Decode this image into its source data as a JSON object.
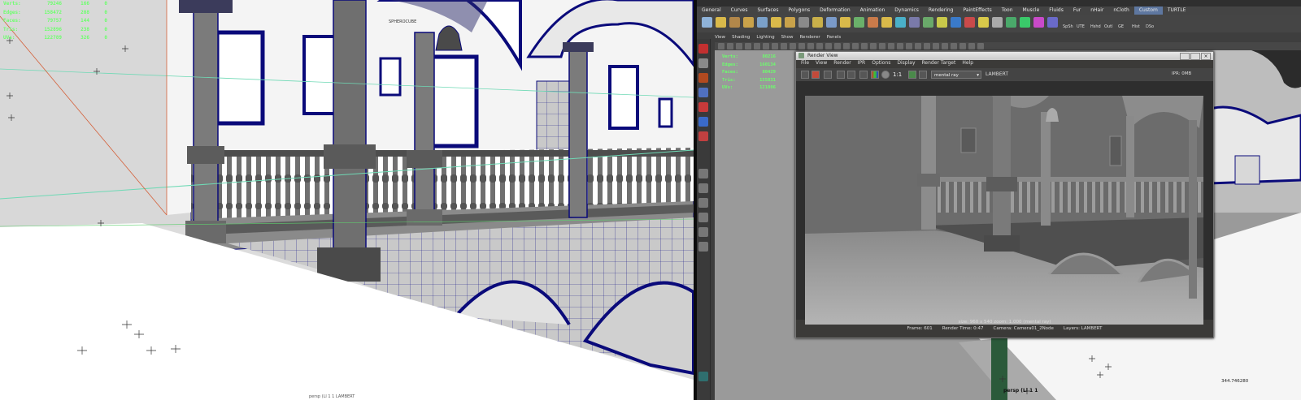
{
  "left_viewport": {
    "hud": [
      {
        "key": "Verts:",
        "v1": "79246",
        "v2": "166",
        "v3": "0"
      },
      {
        "key": "Edges:",
        "v1": "158472",
        "v2": "208",
        "v3": "0"
      },
      {
        "key": "Faces:",
        "v1": "79757",
        "v2": "144",
        "v3": "0"
      },
      {
        "key": "Tris:",
        "v1": "152896",
        "v2": "238",
        "v3": "0"
      },
      {
        "key": "UVs:",
        "v1": "122789",
        "v2": "326",
        "v3": "0"
      }
    ],
    "bell_label": "SPHEROCUBE",
    "footer_text": "persp (Ll 1 1 LAMBERT"
  },
  "shelf": {
    "tabs": [
      "General",
      "Curves",
      "Surfaces",
      "Polygons",
      "Deformation",
      "Animation",
      "Dynamics",
      "Rendering",
      "PaintEffects",
      "Toon",
      "Muscle",
      "Fluids",
      "Fur",
      "nHair",
      "nCloth",
      "Custom",
      "TURTLE"
    ],
    "active_tab": "Custom",
    "icon_labels": [
      "SpSh",
      "UTE",
      "Hshd",
      "Outl",
      "GE",
      "Hist",
      "DSo"
    ]
  },
  "viewport_menu": [
    "View",
    "Shading",
    "Lighting",
    "Show",
    "Renderer",
    "Panels"
  ],
  "right_viewport": {
    "hud": [
      {
        "key": "Verts:",
        "v1": "80216"
      },
      {
        "key": "Edges:",
        "v1": "160134"
      },
      {
        "key": "Faces:",
        "v1": "80429"
      },
      {
        "key": "Tris:",
        "v1": "155831"
      },
      {
        "key": "UVs:",
        "v1": "121806"
      }
    ],
    "camera_label": "persp (Ll 1 1",
    "coord_readout": "344.746280"
  },
  "render_view": {
    "title": "Render View",
    "menu": [
      "File",
      "View",
      "Render",
      "IPR",
      "Options",
      "Display",
      "Render Target",
      "Help"
    ],
    "one_to_one": "1:1",
    "renderer": "mental ray",
    "layer": "LAMBERT",
    "ipr_label": "IPR: 0MB",
    "size_line": "size: 960 x 540 zoom: 1.000    (mental ray)",
    "frame": "Frame: 601",
    "render_time": "Render Time: 0:47",
    "camera": "Camera: Camera01_2Node",
    "layers": "Layers: LAMBERT"
  },
  "colors": {
    "wireframe": "#0a0a7a",
    "hud_green": "#6cff6c",
    "active_tab": "#5e77a0"
  }
}
